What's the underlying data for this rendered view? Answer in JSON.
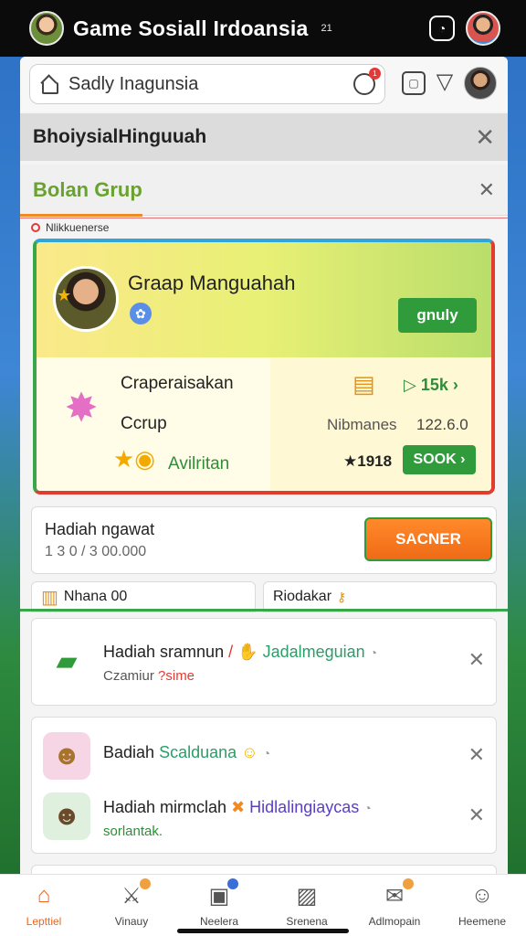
{
  "statusbar": {
    "app_title": "Game Sosiall Irdoansia",
    "small_text": "21"
  },
  "search": {
    "query": "Sadly Inagunsia",
    "badge": "1"
  },
  "headers": {
    "bar1_title": "BhoiysialHinguuah",
    "bar2_title": "Bolan Grup",
    "section_label": "Nlikkuenerse"
  },
  "group_card": {
    "name": "Graap Manguahah",
    "join_button": "gnuly",
    "left_line1": "Craperaisakan",
    "left_line2": "Ccrup",
    "left_line3": "Avilritan",
    "right_value1": "15k",
    "right_label2": "Nibmanes",
    "right_value2": "122.6.0",
    "right_score": "1918",
    "right_button": "SOOK"
  },
  "reward": {
    "title": "Hadiah ngawat",
    "subtitle": "1 3 0 / 3 00.000",
    "button": "SACNER"
  },
  "mini_tabs": {
    "left": "Nhana 00",
    "right": "Riodakar"
  },
  "notifications": [
    {
      "title": "Hadiah sramnun",
      "highlight": "Jadalmeguian",
      "sub_prefix": "Czamiur",
      "sub_highlight": "?sime"
    },
    {
      "title": "Badiah",
      "highlight": "Scalduana",
      "sub_prefix": "",
      "sub_highlight": ""
    },
    {
      "title": "Hadiah mirmclah",
      "highlight": "Hidlalingiaycas",
      "sub_prefix": "",
      "sub_highlight": "sorlantak."
    }
  ],
  "bottom_nav": [
    {
      "label": "Lepttiel",
      "icon": "home-icon",
      "active": true
    },
    {
      "label": "Vinauy",
      "icon": "sword-icon",
      "active": false
    },
    {
      "label": "Neelera",
      "icon": "lock-icon",
      "active": false
    },
    {
      "label": "Srenena",
      "icon": "image-icon",
      "active": false
    },
    {
      "label": "Adlmopain",
      "icon": "mail-icon",
      "active": false
    },
    {
      "label": "Heemene",
      "icon": "profile-icon",
      "active": false
    }
  ],
  "colors": {
    "accent_orange": "#f0641e",
    "accent_green": "#2f9b3b",
    "card_border_red": "#e23b2f"
  }
}
